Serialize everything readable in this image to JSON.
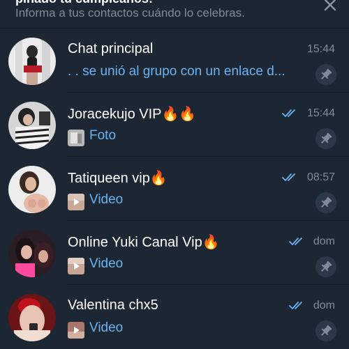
{
  "banner": {
    "title": "pinado tu cumpleaños!",
    "subtitle": "Informa a tus contactos cuándo lo celebras.",
    "close_icon": "close-icon"
  },
  "colors": {
    "background": "#1d2733",
    "accent": "#6ab3f3",
    "muted": "#7f8b98",
    "pin_bg": "#2b3848"
  },
  "chats": [
    {
      "name": "Chat principal",
      "time": "15:44",
      "read_checks": false,
      "preview": ". . se unió al grupo con un enlace d...",
      "thumb": false,
      "pinned": true
    },
    {
      "name": "Joracekujo VIP🔥🔥",
      "time": "15:44",
      "read_checks": true,
      "preview": "Foto",
      "thumb": "photo",
      "pinned": true
    },
    {
      "name": "Tatiqueen vip🔥",
      "time": "08:57",
      "read_checks": true,
      "preview": "Video",
      "thumb": "video",
      "pinned": true
    },
    {
      "name": "Online Yuki Canal Vip🔥",
      "time": "dom",
      "read_checks": true,
      "preview": "Video",
      "thumb": "video",
      "pinned": true
    },
    {
      "name": "Valentina chx5",
      "time": "dom",
      "read_checks": true,
      "preview": "Video",
      "thumb": "video",
      "pinned": true
    }
  ]
}
